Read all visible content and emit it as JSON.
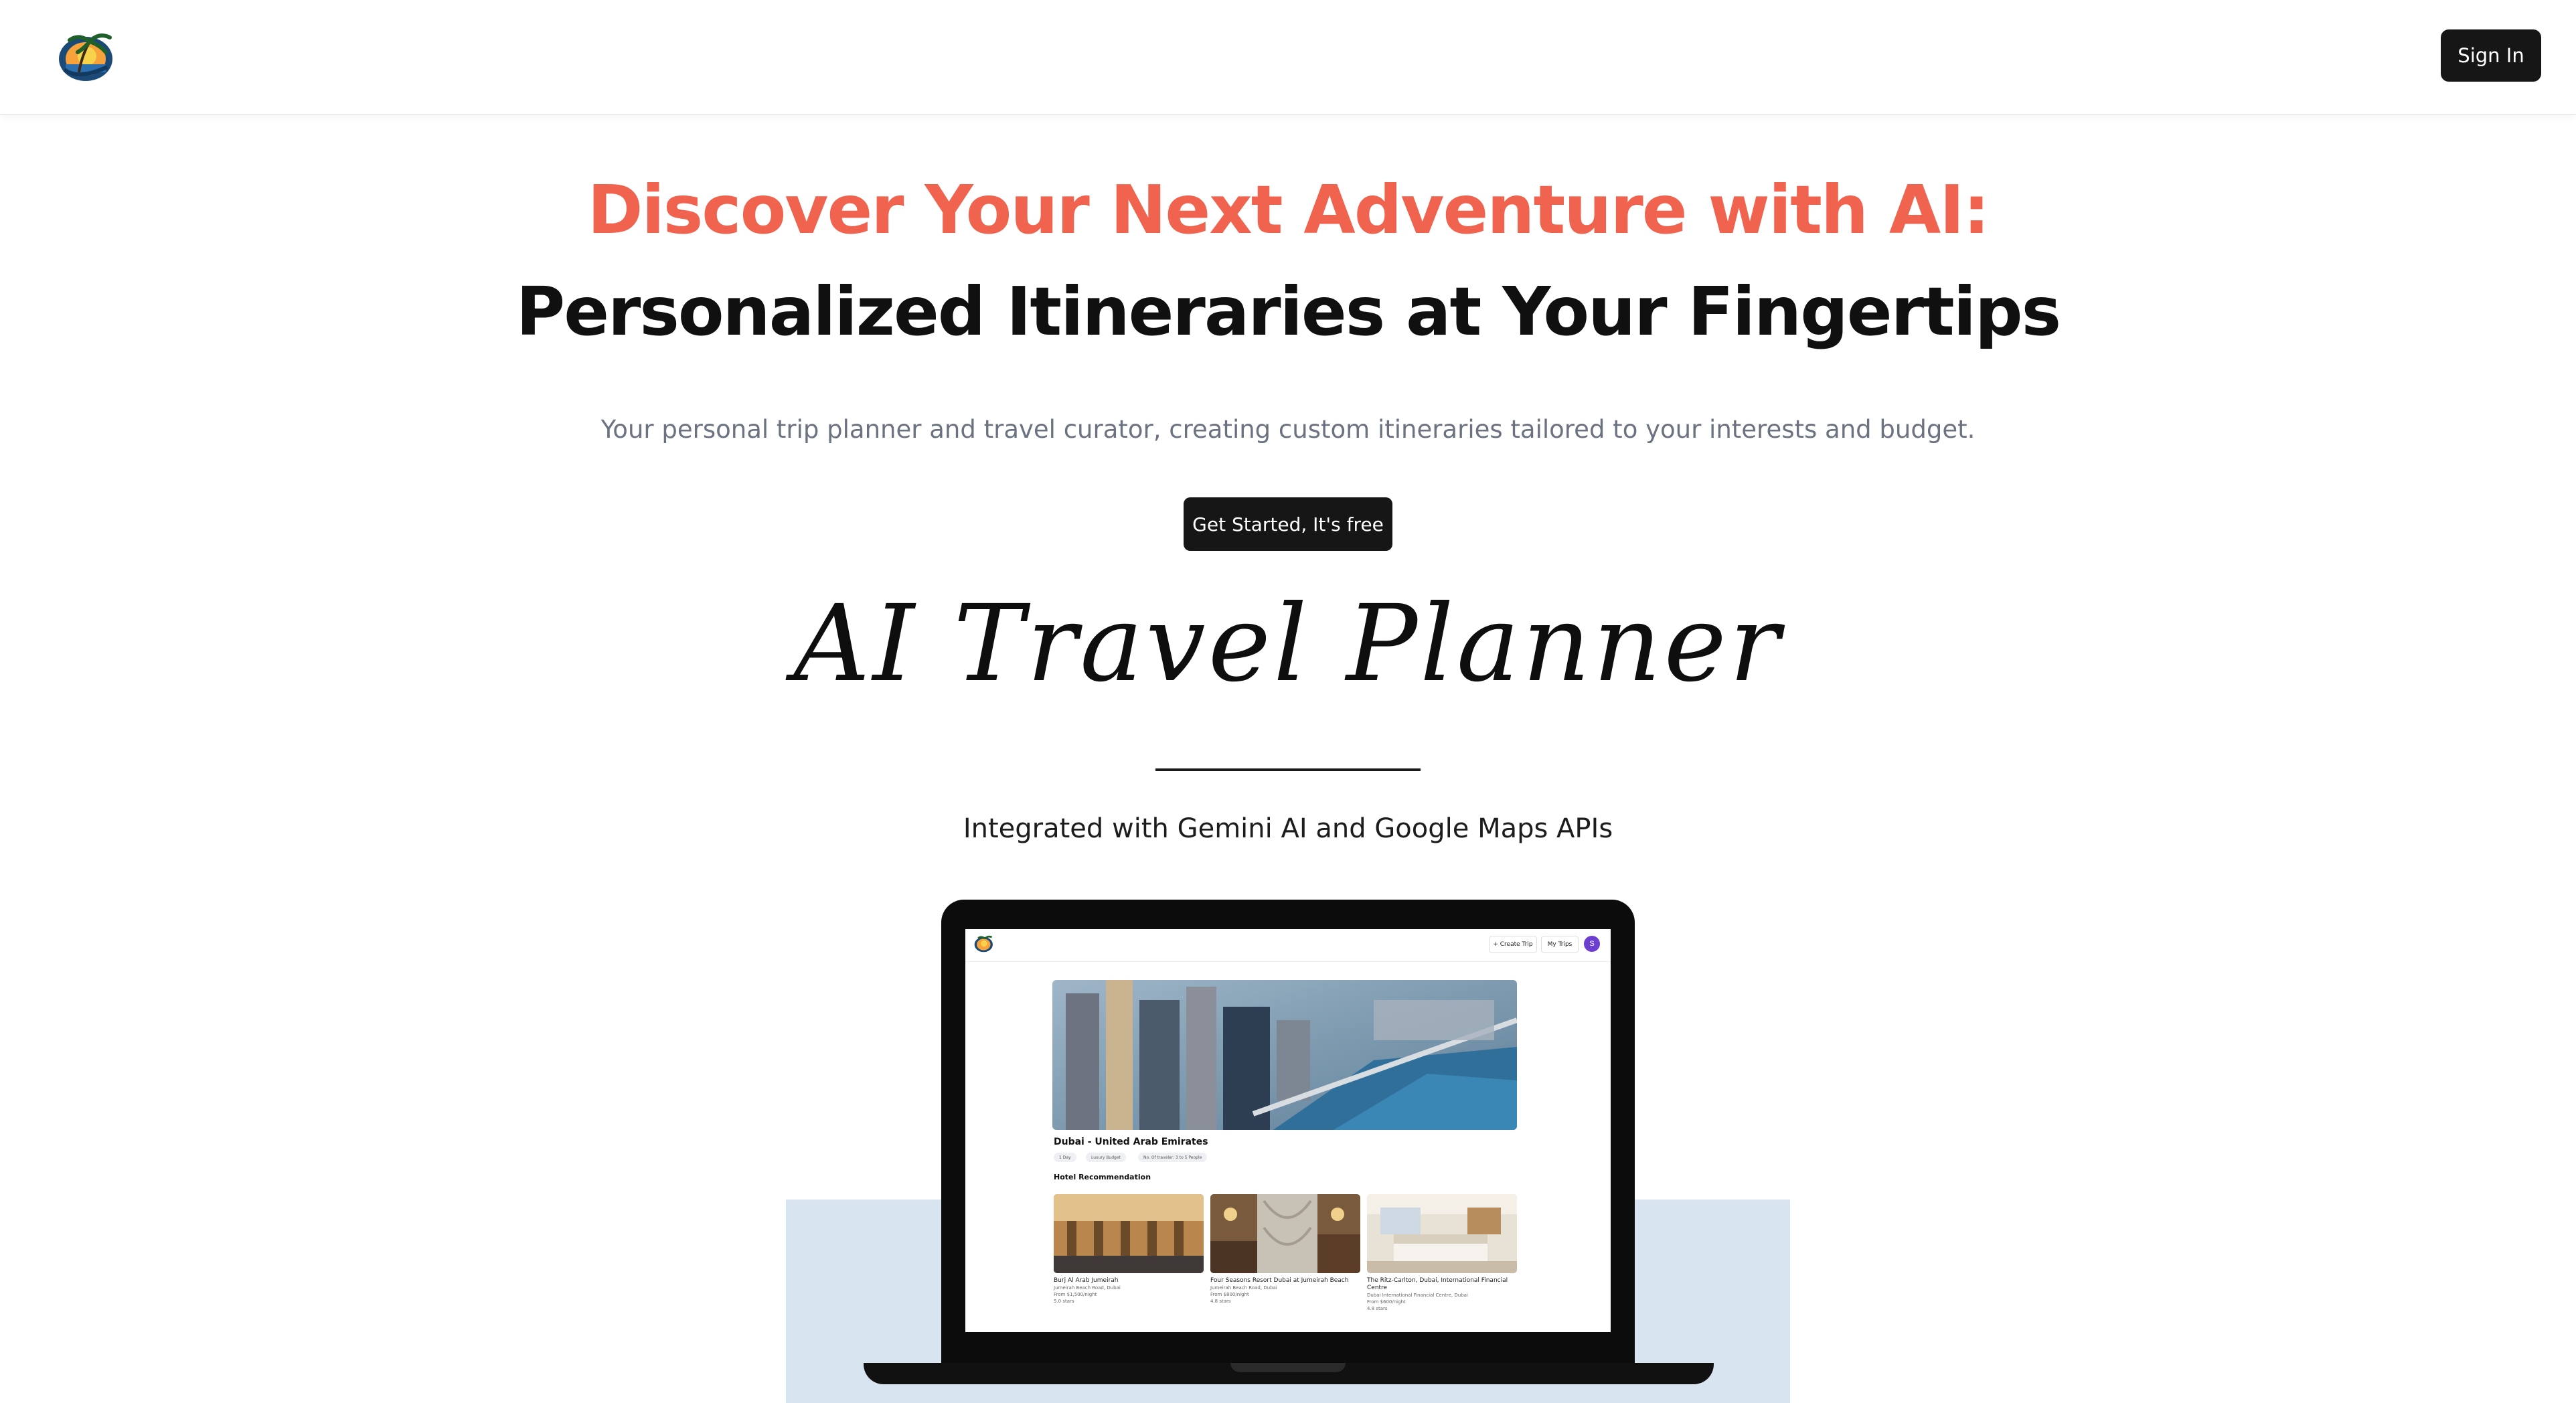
{
  "header": {
    "logo_icon": "palm-tree-sunset-logo-icon",
    "sign_in_label": "Sign In"
  },
  "hero": {
    "title_accent": "Discover Your Next Adventure with AI:",
    "title_rest": "Personalized Itineraries at Your Fingertips",
    "subtitle": "Your personal trip planner and travel curator, creating custom itineraries tailored to your interests and budget.",
    "cta_label": "Get Started, It's free"
  },
  "brand": {
    "title": "AI Travel Planner",
    "integrated": "Integrated with Gemini AI and Google Maps APIs"
  },
  "colors": {
    "accent": "#f0644f",
    "dark_button": "#161616",
    "subtitle_gray": "#6b7280",
    "panel_blue": "#d8e4ef"
  },
  "preview": {
    "nav": {
      "create_trip": "+ Create Trip",
      "my_trips": "My Trips",
      "avatar_initial": "S"
    },
    "destination": "Dubai - United Arab Emirates",
    "chips": [
      "1 Day",
      "Luxury Budget",
      "No. Of traveler: 3 to 5 People"
    ],
    "section_title": "Hotel Recommendation",
    "hotels": [
      {
        "name": "Burj Al Arab Jumeirah",
        "address": "Jumeirah Beach Road, Dubai",
        "price": "From $1,500/night",
        "rating": "5.0 stars"
      },
      {
        "name": "Four Seasons Resort Dubai at Jumeirah Beach",
        "address": "Jumeirah Beach Road, Dubai",
        "price": "From $800/night",
        "rating": "4.8 stars"
      },
      {
        "name": "The Ritz-Carlton, Dubai, International Financial Centre",
        "address": "Dubai International Financial Centre, Dubai",
        "price": "From $600/night",
        "rating": "4.8 stars"
      }
    ]
  }
}
